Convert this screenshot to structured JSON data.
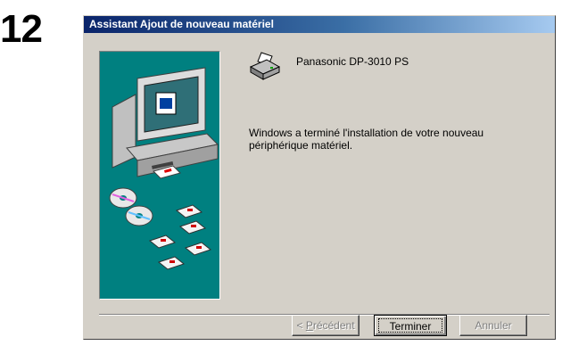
{
  "step": {
    "number": "12"
  },
  "window": {
    "title": "Assistant Ajout de nouveau matériel"
  },
  "device": {
    "name": "Panasonic DP-3010 PS",
    "icon": "printer-icon"
  },
  "message": {
    "text": "Windows a terminé l'installation de votre nouveau périphérique matériel."
  },
  "buttons": {
    "back_prefix": "< ",
    "back_mnemonic": "P",
    "back_rest": "récédent",
    "finish_label": "Terminer",
    "cancel_label": "Annuler"
  },
  "colors": {
    "title_gradient_start": "#0a246a",
    "title_gradient_end": "#a6caf0",
    "dialog_face": "#d4d0c8",
    "art_background": "#008080"
  }
}
